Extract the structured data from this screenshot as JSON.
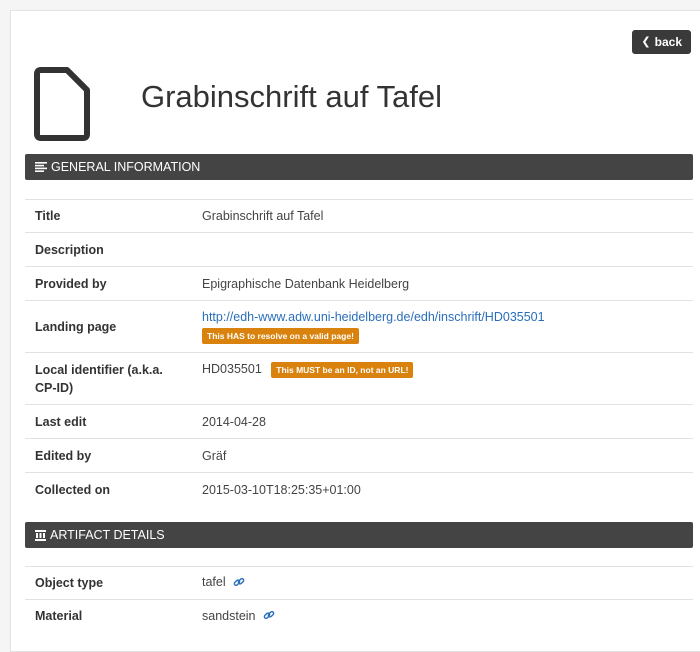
{
  "header": {
    "back_label": "back",
    "title": "Grabinschrift auf Tafel"
  },
  "general_section": {
    "title": "GENERAL INFORMATION",
    "rows": [
      {
        "label": "Title",
        "value": "Grabinschrift auf Tafel"
      },
      {
        "label": "Description",
        "value": ""
      },
      {
        "label": "Provided by",
        "value": "Epigraphische Datenbank Heidelberg"
      },
      {
        "label": "Landing page",
        "value": "http://edh-www.adw.uni-heidelberg.de/edh/inschrift/HD035501",
        "badge": "This HAS to resolve on a valid page!"
      },
      {
        "label": "Local identifier (a.k.a. CP-ID)",
        "value": "HD035501",
        "badge": "This MUST be an ID, not an URL!"
      },
      {
        "label": "Last edit",
        "value": "2014-04-28"
      },
      {
        "label": "Edited by",
        "value": "Gräf"
      },
      {
        "label": "Collected on",
        "value": "2015-03-10T18:25:35+01:00"
      }
    ]
  },
  "artifact_section": {
    "title": "ARTIFACT DETAILS",
    "rows": [
      {
        "label": "Object type",
        "value": "tafel"
      },
      {
        "label": "Material",
        "value": "sandstein"
      }
    ]
  },
  "colors": {
    "header_bg": "#444444",
    "badge_bg": "#d9820d",
    "link": "#2a6ebb"
  }
}
